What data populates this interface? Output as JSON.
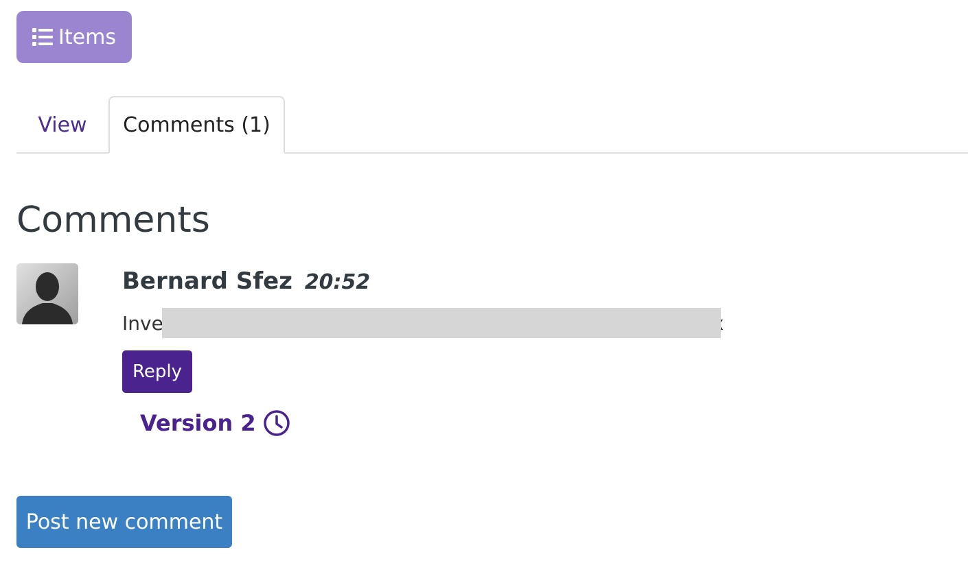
{
  "toolbar": {
    "items_label": "Items",
    "items_icon": "list-icon"
  },
  "tabs": [
    {
      "label": "View",
      "active": false
    },
    {
      "label": "Comments (1)",
      "active": true
    }
  ],
  "comments_section": {
    "heading": "Comments",
    "comments": [
      {
        "author": "Bernard Sfez",
        "time": "20:52",
        "text_visible_start": "Inve",
        "text_visible_end": "ix",
        "reply_label": "Reply",
        "version_label": "Version 2",
        "version_icon": "clock-icon"
      }
    ],
    "post_label": "Post new comment"
  },
  "colors": {
    "items_button": "#9a86d0",
    "brand_purple": "#4b238f",
    "post_button": "#3a80c2",
    "redaction": "#d6d6d6"
  }
}
